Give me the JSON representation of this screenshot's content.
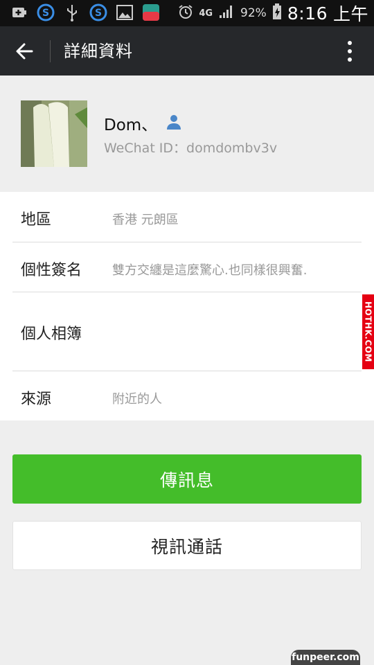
{
  "status_bar": {
    "battery": "92%",
    "network": "4G",
    "time": "8:16",
    "ampm": "上午"
  },
  "header": {
    "title": "詳細資料"
  },
  "profile": {
    "name": "Dom、",
    "wechat_id": "WeChat ID：domdombv3v"
  },
  "details": [
    {
      "label": "地區",
      "value": "香港  元朗區"
    },
    {
      "label": "個性簽名",
      "value": "雙方交纏是這麼驚心.也同樣很興奮."
    },
    {
      "label": "個人相簿",
      "value": ""
    },
    {
      "label": "來源",
      "value": "附近的人"
    }
  ],
  "buttons": {
    "send_message": "傳訊息",
    "video_call": "視訊通話"
  },
  "watermark": "HOTHK.COM",
  "brand": "funpeer.com",
  "colors": {
    "appbar": "#26282b",
    "primary_green": "#44bd2a",
    "background": "#eeeeee"
  }
}
